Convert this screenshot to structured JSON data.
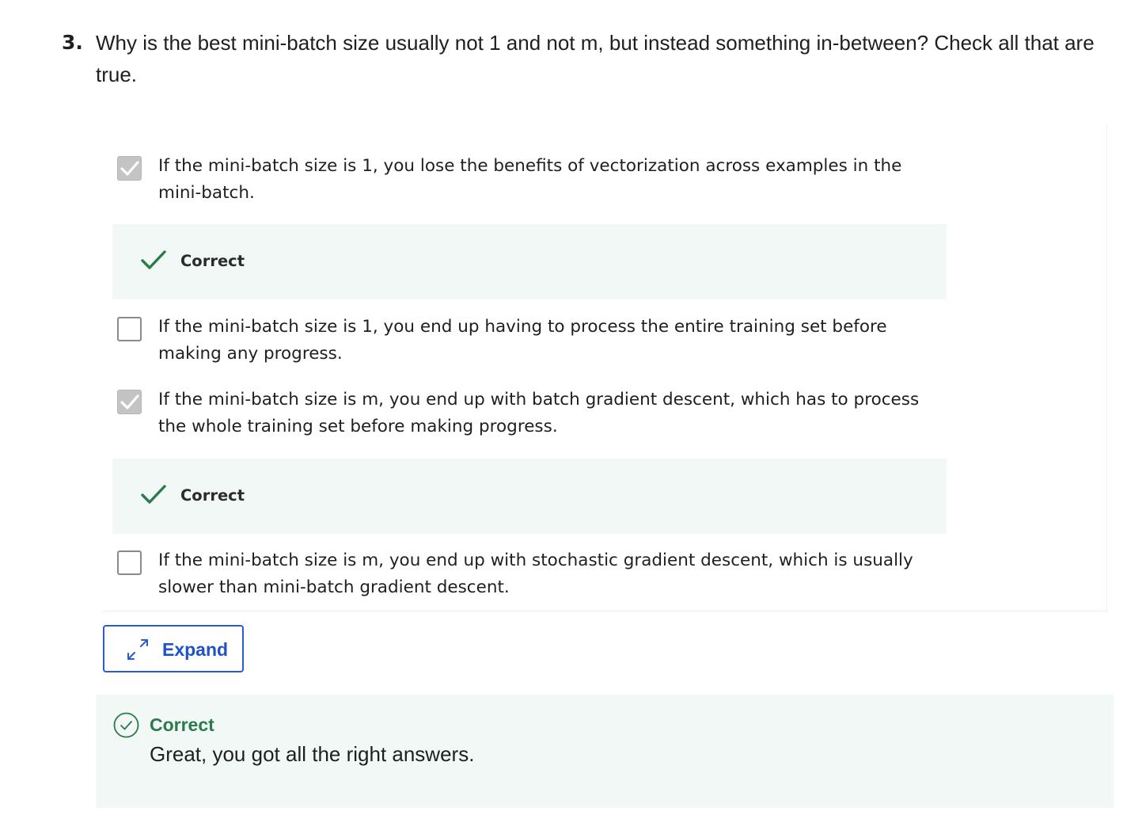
{
  "question": {
    "number": "3.",
    "text": "Why is the best mini-batch size usually not 1 and not m, but instead something in-between? Check all that are true."
  },
  "options": [
    {
      "text": "If the mini-batch size is 1, you lose the benefits of vectorization across examples in the mini-batch.",
      "checked": true,
      "feedback": "Correct"
    },
    {
      "text": "If the mini-batch size is 1, you end up having to process the entire training set before making any progress.",
      "checked": false
    },
    {
      "text": "If the mini-batch size is m, you end up with batch gradient descent, which has to process the whole training set before making progress.",
      "checked": true,
      "feedback": "Correct"
    },
    {
      "text": "If the mini-batch size is m, you end up with stochastic gradient descent, which is usually slower than mini-batch gradient descent.",
      "checked": false
    }
  ],
  "expand_button": {
    "label": "Expand",
    "icon": "expand-arrows-icon"
  },
  "result": {
    "title": "Correct",
    "message": "Great, you got all the right answers.",
    "icon": "check-circle-icon"
  },
  "colors": {
    "success_green": "#2a7a4b",
    "feedback_bg": "#f2f8f5",
    "button_blue": "#1f52c7",
    "checkbox_checked_bg": "#c4c4c4"
  }
}
